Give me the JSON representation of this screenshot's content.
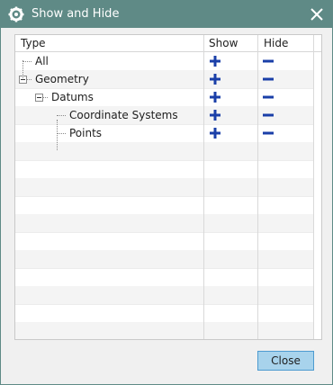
{
  "window": {
    "title": "Show and Hide",
    "title_icon": "gear-icon",
    "close_icon": "close-icon"
  },
  "table": {
    "columns": [
      "Type",
      "Show",
      "Hide"
    ],
    "rows": [
      {
        "label": "All",
        "level": 0,
        "expander": false
      },
      {
        "label": "Geometry",
        "level": 0,
        "expander": true
      },
      {
        "label": "Datums",
        "level": 1,
        "expander": true
      },
      {
        "label": "Coordinate Systems",
        "level": 2,
        "expander": false
      },
      {
        "label": "Points",
        "level": 2,
        "expander": false
      }
    ],
    "show_icon": "plus-icon",
    "hide_icon": "minus-icon",
    "icon_color": "#1a3fa8"
  },
  "footer": {
    "close_label": "Close"
  },
  "colors": {
    "titlebar": "#5f8a86",
    "button_bg": "#a8d3ec",
    "button_border": "#4d9bd0"
  }
}
